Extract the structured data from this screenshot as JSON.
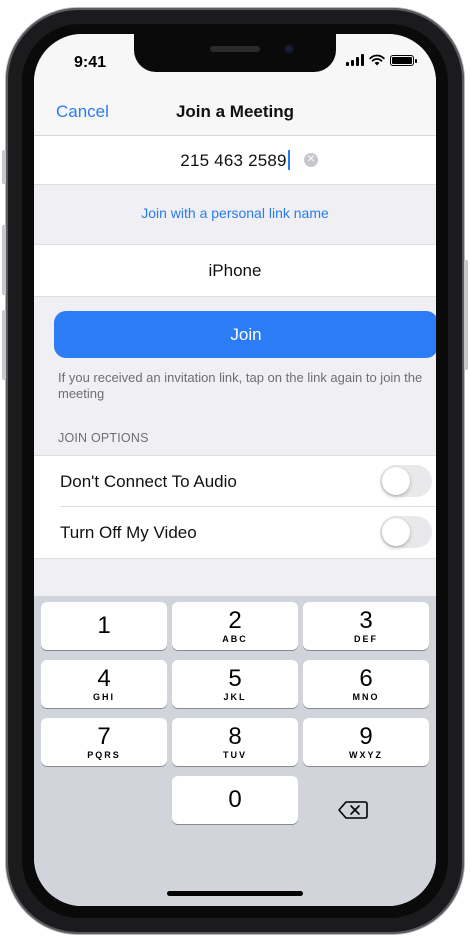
{
  "status_bar": {
    "time": "9:41",
    "icons": [
      "signal-icon",
      "wifi-icon",
      "battery-icon"
    ]
  },
  "nav": {
    "cancel_label": "Cancel",
    "title": "Join a Meeting"
  },
  "meeting_id": {
    "value": "215 463 2589",
    "clear_icon": "clear-icon"
  },
  "personal_link_label": "Join with a personal link name",
  "display_name": {
    "value": "iPhone"
  },
  "join": {
    "label": "Join",
    "hint": "If you received an invitation link, tap on the link again to join the meeting"
  },
  "join_options": {
    "header": "JOIN OPTIONS",
    "items": [
      {
        "label": "Don't Connect To Audio",
        "enabled": false
      },
      {
        "label": "Turn Off My Video",
        "enabled": false
      }
    ]
  },
  "keypad": {
    "keys": [
      {
        "digit": "1",
        "letters": ""
      },
      {
        "digit": "2",
        "letters": "ABC"
      },
      {
        "digit": "3",
        "letters": "DEF"
      },
      {
        "digit": "4",
        "letters": "GHI"
      },
      {
        "digit": "5",
        "letters": "JKL"
      },
      {
        "digit": "6",
        "letters": "MNO"
      },
      {
        "digit": "7",
        "letters": "PQRS"
      },
      {
        "digit": "8",
        "letters": "TUV"
      },
      {
        "digit": "9",
        "letters": "WXYZ"
      },
      {
        "digit": "0",
        "letters": ""
      }
    ],
    "delete_icon": "backspace-icon"
  },
  "colors": {
    "accent": "#2b7cf5",
    "background": "#efeff4",
    "keypad": "#d1d4db"
  }
}
